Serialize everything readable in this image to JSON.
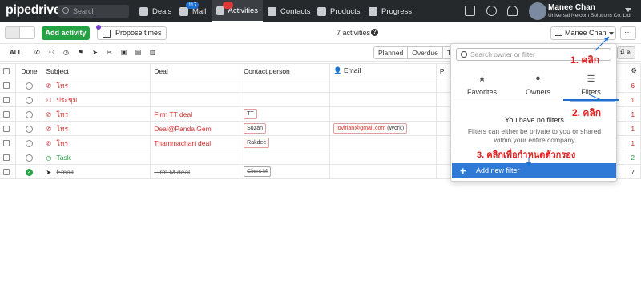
{
  "topbar": {
    "logo": "pipedrive",
    "search_placeholder": "Search",
    "nav": [
      {
        "label": "Deals"
      },
      {
        "label": "Mail",
        "badge": "117"
      },
      {
        "label": "Activities",
        "badge": "22",
        "active": true
      },
      {
        "label": "Contacts"
      },
      {
        "label": "Products"
      },
      {
        "label": "Progress"
      }
    ],
    "user_name": "Manee Chan",
    "user_company": "Universal Netcom Solutions Co. Ltd."
  },
  "toolbar": {
    "add_activity": "Add activity",
    "propose_times": "Propose times",
    "activity_count": "7 activities",
    "owner_filter": "Manee Chan",
    "more": "···"
  },
  "filters": {
    "all": "ALL",
    "segments": [
      "Planned",
      "Overdue",
      "To"
    ],
    "right_seg": "มี.ค."
  },
  "table": {
    "headers": [
      "Done",
      "Subject",
      "Deal",
      "Contact person",
      "Email",
      "P"
    ],
    "rows": [
      {
        "done": false,
        "subject": "โทร",
        "subject_icon": "phone",
        "deal": "",
        "contact": "",
        "email": "",
        "style": "red",
        "right": "6"
      },
      {
        "done": false,
        "subject": "ประชุม",
        "subject_icon": "meeting",
        "deal": "",
        "contact": "",
        "email": "",
        "style": "red",
        "right": "1"
      },
      {
        "done": false,
        "subject": "โทร",
        "subject_icon": "phone",
        "deal": "Firm TT deal",
        "contact": "TT",
        "email": "",
        "style": "red",
        "right": "1"
      },
      {
        "done": false,
        "subject": "โทร",
        "subject_icon": "phone",
        "deal": "Deal@Panda Gem",
        "contact": "Suzan",
        "email": "lovirian@gmail.com",
        "email_tag": "(Work)",
        "style": "red",
        "right": "1"
      },
      {
        "done": false,
        "subject": "โทร",
        "subject_icon": "phone",
        "deal": "Thammachart deal",
        "contact": "Rakdee",
        "email": "",
        "style": "red",
        "right": "1"
      },
      {
        "done": false,
        "subject": "Task",
        "subject_icon": "clock",
        "deal": "",
        "contact": "",
        "email": "",
        "style": "green",
        "right": "2"
      },
      {
        "done": true,
        "subject": "Email",
        "subject_icon": "send",
        "deal": "Firm M deal",
        "contact": "Client M",
        "email": "",
        "style": "strike",
        "right": "7"
      }
    ]
  },
  "panel": {
    "search_placeholder": "Search owner or filter",
    "tabs": [
      "Favorites",
      "Owners",
      "Filters"
    ],
    "no_filters_title": "You have no filters",
    "no_filters_desc": "Filters can either be private to you or shared within your entire company",
    "add_new_filter": "Add new filter"
  },
  "annotations": {
    "step1": "1. คลิก",
    "step2": "2. คลิก",
    "step3": "3. คลิกเพื่อกำหนดตัวกรอง"
  },
  "colors": {
    "topbar": "#26292c",
    "add_green": "#25a244",
    "overdue_red": "#d92c2c",
    "filter_blue": "#2f7ad6",
    "annotation_red": "#e02020"
  }
}
